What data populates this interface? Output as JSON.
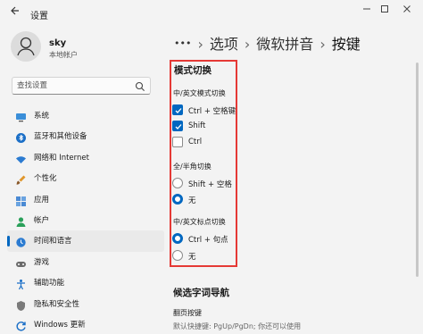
{
  "window": {
    "title": "设置"
  },
  "profile": {
    "name": "sky",
    "subtitle": "本地帐户"
  },
  "search": {
    "placeholder": "查找设置"
  },
  "sidebar": {
    "items": [
      {
        "label": "系统",
        "icon": "display-icon"
      },
      {
        "label": "蓝牙和其他设备",
        "icon": "bluetooth-icon"
      },
      {
        "label": "网络和 Internet",
        "icon": "wifi-icon"
      },
      {
        "label": "个性化",
        "icon": "brush-icon"
      },
      {
        "label": "应用",
        "icon": "apps-icon"
      },
      {
        "label": "帐户",
        "icon": "person-icon"
      },
      {
        "label": "时间和语言",
        "icon": "globe-clock-icon",
        "active": true
      },
      {
        "label": "游戏",
        "icon": "gamepad-icon"
      },
      {
        "label": "辅助功能",
        "icon": "accessibility-icon"
      },
      {
        "label": "隐私和安全性",
        "icon": "shield-icon"
      },
      {
        "label": "Windows 更新",
        "icon": "update-icon"
      }
    ]
  },
  "breadcrumb": {
    "ellipsis": "•••",
    "items": [
      "选项",
      "微软拼音",
      "按键"
    ],
    "separator": "›"
  },
  "mode_switch": {
    "title": "模式切换",
    "groups": [
      {
        "label": "中/英文模式切换",
        "type": "checkbox",
        "options": [
          {
            "label": "Ctrl + 空格键",
            "checked": true
          },
          {
            "label": "Shift",
            "checked": true
          },
          {
            "label": "Ctrl",
            "checked": false
          }
        ]
      },
      {
        "label": "全/半角切换",
        "type": "radio",
        "options": [
          {
            "label": "Shift + 空格",
            "checked": false
          },
          {
            "label": "无",
            "checked": true
          }
        ]
      },
      {
        "label": "中/英文标点切换",
        "type": "radio",
        "options": [
          {
            "label": "Ctrl + 句点",
            "checked": true
          },
          {
            "label": "无",
            "checked": false
          }
        ]
      }
    ]
  },
  "candidate_nav": {
    "title": "候选字词导航",
    "page_turn_label": "翻页按键",
    "page_turn_desc": "默认快捷键: PgUp/PgDn; 你还可以使用"
  },
  "colors": {
    "accent": "#0067c0",
    "highlight": "#e53935"
  }
}
